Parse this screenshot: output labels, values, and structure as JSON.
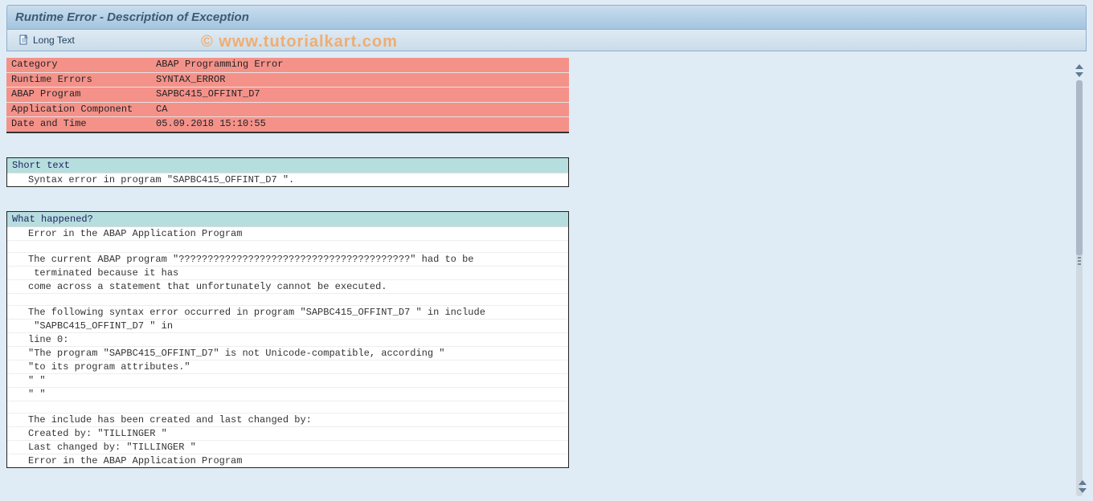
{
  "title": "Runtime Error - Description of Exception",
  "toolbar": {
    "long_text_label": "Long Text"
  },
  "watermark": "© www.tutorialkart.com",
  "info_rows": [
    {
      "label": "Category",
      "value": "ABAP Programming Error"
    },
    {
      "label": "Runtime Errors",
      "value": "SYNTAX_ERROR"
    },
    {
      "label": "ABAP Program",
      "value": "SAPBC415_OFFINT_D7"
    },
    {
      "label": "Application Component",
      "value": "CA"
    },
    {
      "label": "Date and Time",
      "value": "05.09.2018 15:10:55"
    }
  ],
  "short_text": {
    "header": "Short text",
    "lines": [
      "Syntax error in program \"SAPBC415_OFFINT_D7 \"."
    ]
  },
  "what_happened": {
    "header": "What happened?",
    "lines": [
      "Error in the ABAP Application Program",
      "",
      "The current ABAP program \"????????????????????????????????????????\" had to be",
      " terminated because it has",
      "come across a statement that unfortunately cannot be executed.",
      "",
      "The following syntax error occurred in program \"SAPBC415_OFFINT_D7 \" in include",
      " \"SAPBC415_OFFINT_D7 \" in",
      "line 0:",
      "\"The program \"SAPBC415_OFFINT_D7\" is not Unicode-compatible, according \"",
      "\"to its program attributes.\"",
      "\" \"",
      "\" \"",
      "",
      "The include has been created and last changed by:",
      "Created by: \"TILLINGER \"",
      "Last changed by: \"TILLINGER \"",
      "Error in the ABAP Application Program"
    ]
  }
}
